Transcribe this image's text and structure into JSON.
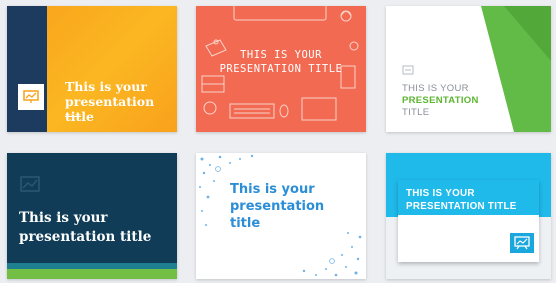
{
  "templates": [
    {
      "title_line1": "This is your",
      "title_line2": "presentation title",
      "accent": "#fbb722",
      "band": "#1d3b5e",
      "icon": "presentation-board-icon"
    },
    {
      "title_line1": "THIS IS YOUR",
      "title_line2": "PRESENTATION TITLE",
      "accent": "#f26a52",
      "icon": "office-doodles"
    },
    {
      "title_line1": "THIS IS YOUR",
      "title_line2": "PRESENTATION",
      "title_line3": "TITLE",
      "accent": "#5bb630",
      "icon": "presentation-icon"
    },
    {
      "title_line1": "This is your",
      "title_line2": "presentation title",
      "accent": "#103c57",
      "stripe": "#73bf45",
      "icon": "chart-icon"
    },
    {
      "title_line1": "This is your",
      "title_line2": "presentation",
      "title_line3": "title",
      "accent": "#2b8ed6",
      "icon": "dot-pattern"
    },
    {
      "title_line1": "THIS IS YOUR",
      "title_line2": "PRESENTATION TITLE",
      "accent": "#1fb9ea",
      "icon": "chart-board-icon"
    }
  ]
}
